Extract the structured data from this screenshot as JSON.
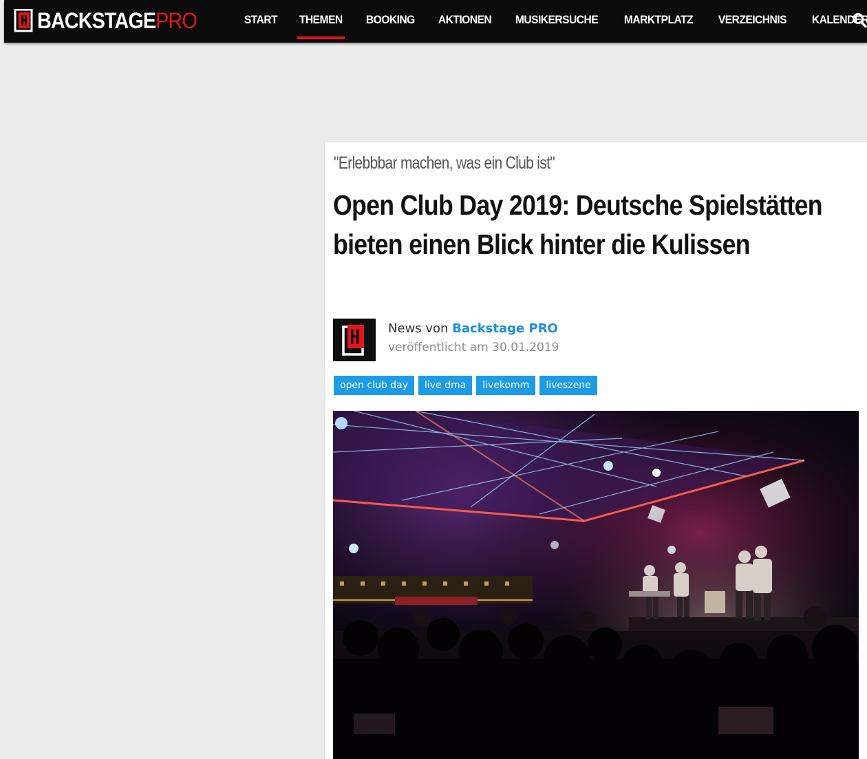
{
  "header": {
    "logo": {
      "brand": "BACKSTAGE",
      "suffix": "PRO"
    },
    "nav": [
      {
        "label": "START",
        "active": false
      },
      {
        "label": "THEMEN",
        "active": true
      },
      {
        "label": "BOOKING",
        "active": false
      },
      {
        "label": "AKTIONEN",
        "active": false
      },
      {
        "label": "MUSIKERSUCHE",
        "active": false
      },
      {
        "label": "MARKTPLATZ",
        "active": false
      },
      {
        "label": "VERZEICHNIS",
        "active": false
      },
      {
        "label": "KALENDER",
        "active": false
      }
    ],
    "search_icon": "search-icon"
  },
  "article": {
    "kicker": "\"Erlebbbar machen, was ein Club ist\"",
    "title": "Open Club Day 2019: Deutsche Spielstätten bieten einen Blick hinter die Kulissen",
    "author": {
      "prefix": "News von",
      "name": "Backstage PRO",
      "published": "veröffentlicht am 30.01.2019"
    },
    "tags": [
      "open club day",
      "live dma",
      "livekomm",
      "liveszene"
    ],
    "image": "concert-photo"
  },
  "colors": {
    "accent": "#e3141a",
    "link": "#1a8ed8",
    "tag": "#1c9be6",
    "nav_bg": "#0b0b0b",
    "page_bg": "#ebebeb"
  }
}
